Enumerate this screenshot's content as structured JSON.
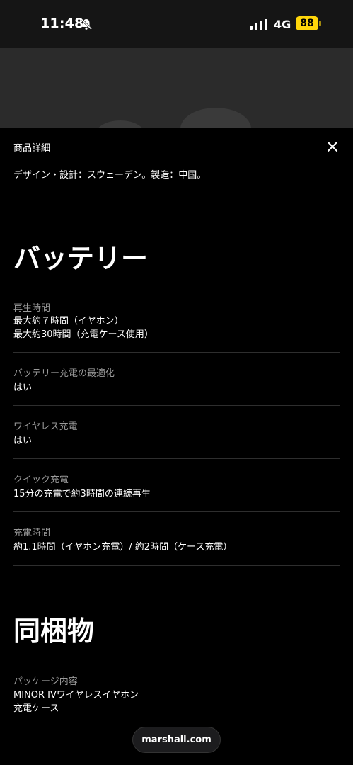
{
  "status_bar": {
    "time": "11:48",
    "network": "4G",
    "battery": "88",
    "battery_color": "#ffd60a"
  },
  "sheet": {
    "title": "商品詳細",
    "close_icon": "close-icon",
    "prev_line": "デザイン・設計：スウェーデン。製造：中国。"
  },
  "battery_section": {
    "heading": "バッテリー",
    "specs": [
      {
        "label": "再生時間",
        "values": [
          "最大約７時間（イヤホン）",
          "最大約30時間（充電ケース使用）"
        ]
      },
      {
        "label": "バッテリー充電の最適化",
        "values": [
          "はい"
        ]
      },
      {
        "label": "ワイヤレス充電",
        "values": [
          "はい"
        ]
      },
      {
        "label": "クイック充電",
        "values": [
          "15分の充電で約3時間の連続再生"
        ]
      },
      {
        "label": "充電時間",
        "values": [
          "約1.1時間（イヤホン充電）/ 約2時間（ケース充電）"
        ]
      }
    ]
  },
  "contents_section": {
    "heading": "同梱物",
    "specs": [
      {
        "label": "パッケージ内容",
        "values": [
          "MINOR IVワイヤレスイヤホン",
          "充電ケース"
        ]
      }
    ]
  },
  "footer": {
    "domain": "marshall.com"
  }
}
